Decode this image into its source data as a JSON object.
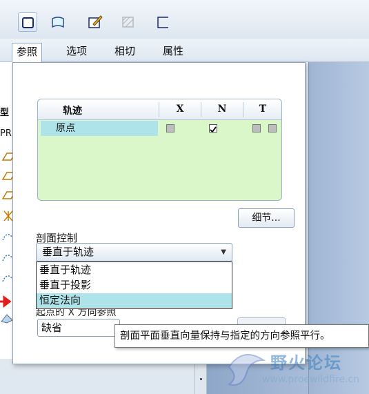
{
  "toolbar": {
    "buttons": [
      "surface-icon",
      "open-surface-icon",
      "sketch-icon",
      "hatch-icon",
      "thin-icon"
    ]
  },
  "tabs": [
    {
      "label": "参照"
    },
    {
      "label": "选项"
    },
    {
      "label": "相切"
    },
    {
      "label": "属性"
    }
  ],
  "model_pane": {
    "partial_labels": [
      "",
      "型",
      "PR"
    ]
  },
  "trajectory_table": {
    "headers": {
      "name": "轨迹",
      "x": "X",
      "n": "N",
      "t": "T"
    },
    "rows": [
      {
        "name": "原点",
        "x": false,
        "n": true,
        "t": [
          false,
          false
        ]
      }
    ]
  },
  "details_button": "细节...",
  "section_control": {
    "label": "剖面控制",
    "selected": "垂直于轨迹",
    "options": [
      "垂直于轨迹",
      "垂直于投影",
      "恒定法向"
    ],
    "highlighted_index": 2
  },
  "x_direction": {
    "label": "起点的 X 方向参照",
    "value": "缺省"
  },
  "tooltip": "剖面平面垂直向量保持与指定的方向参照平行。",
  "watermark": {
    "title": "野火论坛",
    "url": "www.proewildfire.cn"
  },
  "colors": {
    "table_bg": "#d9f7c9",
    "selection": "#aee3e9",
    "graphics_bg": "#a9bdd9"
  }
}
